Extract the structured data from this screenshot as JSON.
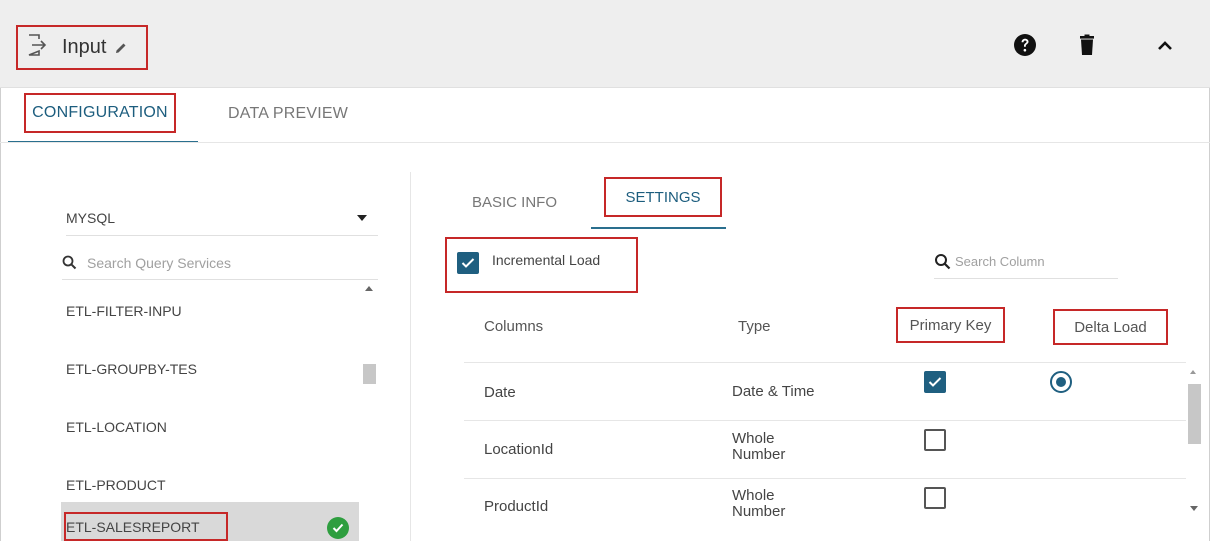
{
  "header": {
    "title": "Input",
    "icons": {
      "input": "input-arrow-icon",
      "edit": "pencil-icon",
      "help": "help-icon",
      "delete": "trash-icon",
      "collapse": "chevron-up-icon"
    }
  },
  "tabs": [
    {
      "label": "CONFIGURATION",
      "active": true
    },
    {
      "label": "DATA PREVIEW",
      "active": false
    }
  ],
  "left": {
    "database": "MYSQL",
    "search_placeholder": "Search Query Services",
    "services": [
      {
        "label": "ETL-FILTER-INPU",
        "selected": false
      },
      {
        "label": "ETL-GROUPBY-TES",
        "selected": false
      },
      {
        "label": "ETL-LOCATION",
        "selected": false
      },
      {
        "label": "ETL-PRODUCT",
        "selected": false
      },
      {
        "label": "ETL-SALESREPORT",
        "selected": true
      }
    ]
  },
  "subtabs": [
    {
      "label": "BASIC INFO",
      "active": false
    },
    {
      "label": "SETTINGS",
      "active": true
    }
  ],
  "settings": {
    "incremental_label": "Incremental Load",
    "incremental_checked": true,
    "search_placeholder": "Search Column",
    "headers": {
      "columns": "Columns",
      "type": "Type",
      "primary_key": "Primary Key",
      "delta_load": "Delta Load"
    },
    "rows": [
      {
        "column": "Date",
        "type": "Date & Time",
        "primary_key": true,
        "delta_load": true
      },
      {
        "column": "LocationId",
        "type": "Whole Number",
        "primary_key": false,
        "delta_load": false
      },
      {
        "column": "ProductId",
        "type": "Whole Number",
        "primary_key": false,
        "delta_load": false
      }
    ]
  },
  "colors": {
    "accent": "#1f5f80",
    "highlight_box": "#c62828",
    "success": "#2e9e3f",
    "header_bg": "#eeeeee"
  }
}
